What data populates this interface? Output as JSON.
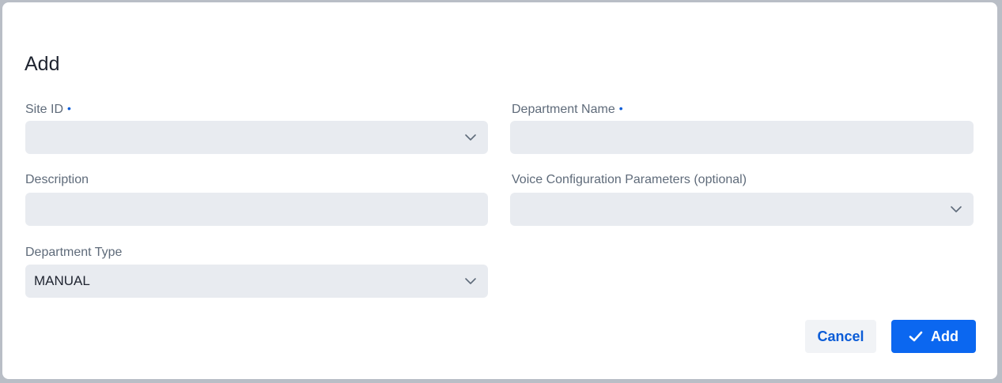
{
  "dialog": {
    "title": "Add"
  },
  "fields": {
    "site_id": {
      "label": "Site ID",
      "required_marker": "•",
      "value": ""
    },
    "department_name": {
      "label": "Department Name",
      "required_marker": "•",
      "value": ""
    },
    "description": {
      "label": "Description",
      "value": ""
    },
    "voice_config": {
      "label": "Voice Configuration Parameters (optional)",
      "value": ""
    },
    "department_type": {
      "label": "Department Type",
      "value": "MANUAL"
    }
  },
  "buttons": {
    "cancel_label": "Cancel",
    "add_label": "Add"
  },
  "icons": {
    "dropdown": "chevron-down-icon",
    "confirm": "check-icon"
  },
  "colors": {
    "accent": "#0b67f0",
    "link": "#0b5cd7",
    "input_bg": "#e8ebf0"
  }
}
